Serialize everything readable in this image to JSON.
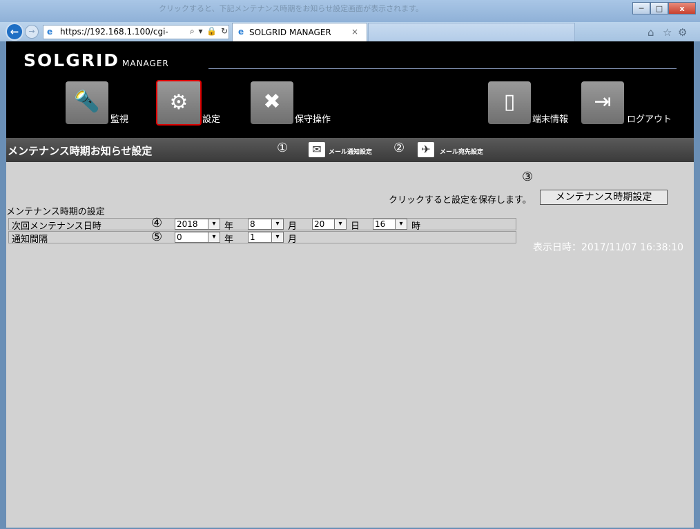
{
  "browser": {
    "window_title": "クリックすると、下記メンテナンス時期をお知らせ設定画面が表示されます。",
    "url": "https://192.168.1.100/cgi-",
    "tab_title": "SOLGRID MANAGER",
    "tab_close": "×",
    "back": "←",
    "forward": "→",
    "addr_tools": "⌕ ▾ 🔒 ↻",
    "ie_icon": "e",
    "minimize": "─",
    "maximize": "□",
    "close": "x",
    "home": "⌂",
    "favorites": "☆",
    "settings": "⚙"
  },
  "header": {
    "logo": "SOLGRID",
    "logo_sub": "MANAGER",
    "nav": [
      {
        "label": "監視",
        "icon": "monitor-icon",
        "glyph": "🔦"
      },
      {
        "label": "設定",
        "icon": "gear-icon",
        "glyph": "⚙"
      },
      {
        "label": "保守操作",
        "icon": "tools-icon",
        "glyph": "✖"
      },
      {
        "label": "端末情報",
        "icon": "device-icon",
        "glyph": "▯"
      },
      {
        "label": "ログアウト",
        "icon": "logout-icon",
        "glyph": "⇥"
      }
    ]
  },
  "subheader": {
    "title": "メンテナンス時期お知らせ設定",
    "marker1": "①",
    "mail_notify_label": "メール通知設定",
    "marker2": "②",
    "mail_dest_label": "メール宛先設定",
    "display_time": "表示日時：2017/11/07 16:38:10",
    "mail_glyph": "✉",
    "dest_glyph": "✈"
  },
  "main": {
    "marker3": "③",
    "save_hint": "クリックすると設定を保存します。",
    "save_button": "メンテナンス時期設定",
    "section_title": "メンテナンス時期の設定",
    "rows": [
      {
        "label": "次回メンテナンス日時",
        "marker": "④",
        "fields": [
          {
            "value": "2018",
            "unit": "年"
          },
          {
            "value": "8",
            "unit": "月"
          },
          {
            "value": "20",
            "unit": "日"
          },
          {
            "value": "16",
            "unit": "時"
          }
        ]
      },
      {
        "label": "通知間隔",
        "marker": "⑤",
        "fields": [
          {
            "value": "0",
            "unit": "年"
          },
          {
            "value": "1",
            "unit": "月"
          }
        ]
      }
    ],
    "dropdown_arrow": "▾"
  },
  "colors": {
    "header_bg": "#000000",
    "subheader_bg": "#4a4a4a",
    "content_bg": "#d2d2d2",
    "selected_border": "#dd0000"
  }
}
